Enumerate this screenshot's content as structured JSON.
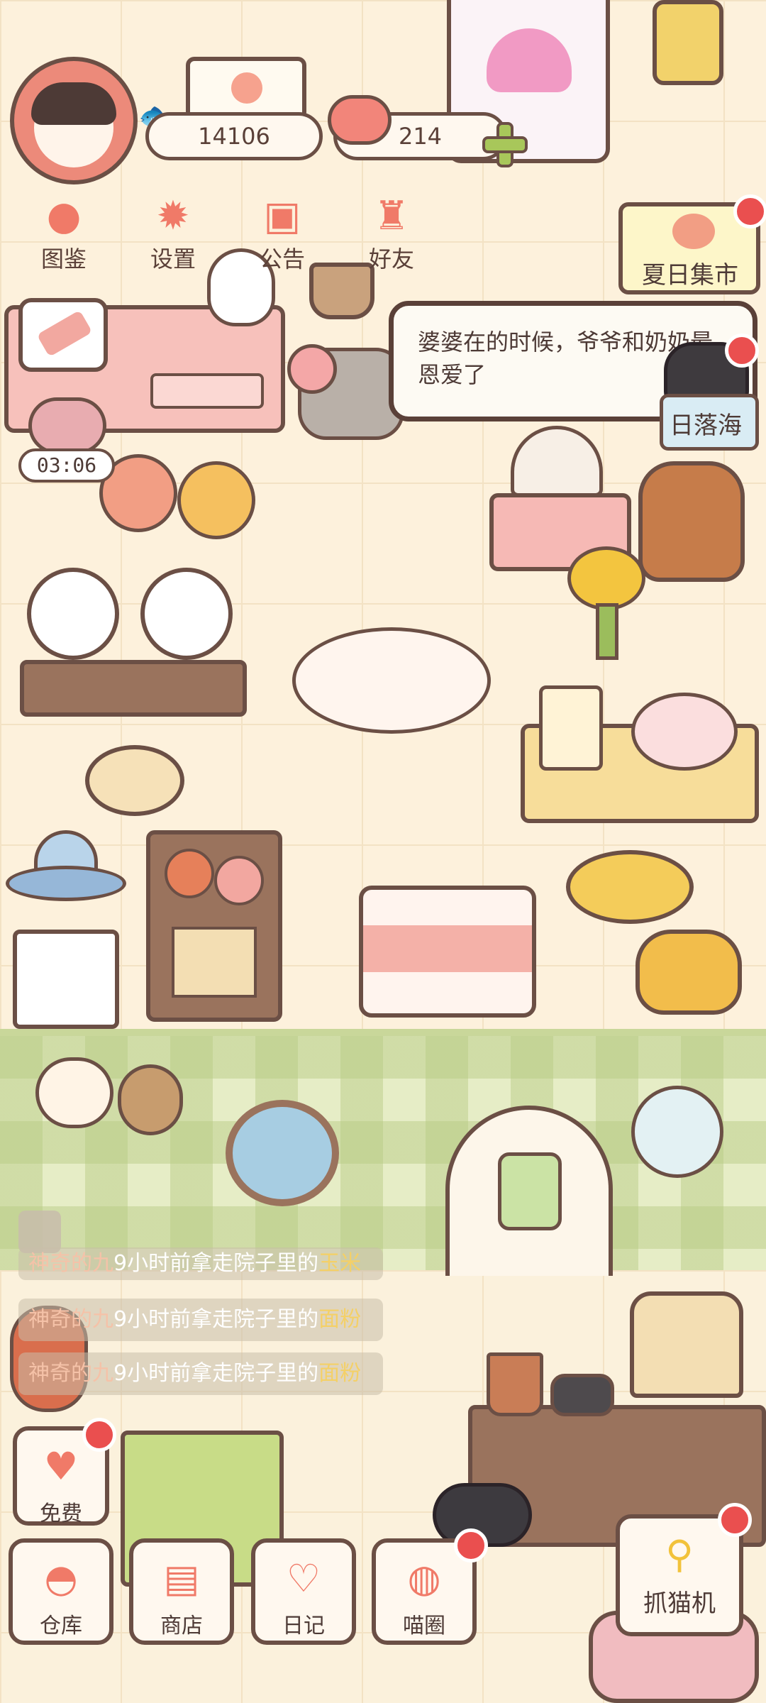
{
  "hud": {
    "coins": "14106",
    "hearts": "214",
    "menu": [
      {
        "label": "图鉴",
        "icon": "cat-head-icon"
      },
      {
        "label": "设置",
        "icon": "gear-icon"
      },
      {
        "label": "公告",
        "icon": "gift-icon"
      },
      {
        "label": "好友",
        "icon": "friends-icon"
      }
    ]
  },
  "events": {
    "summer_market": "夏日集市",
    "sunset_sea": "日落海"
  },
  "dialog": {
    "text": "婆婆在的时候，爷爷和奶奶最恩爱了"
  },
  "timer": "03:06",
  "feed": [
    {
      "who": "神奇的九",
      "mid": "9小时前拿走院子里的",
      "item": "玉米"
    },
    {
      "who": "神奇的九",
      "mid": "9小时前拿走院子里的",
      "item": "面粉"
    },
    {
      "who": "神奇的九",
      "mid": "9小时前拿走院子里的",
      "item": "面粉"
    }
  ],
  "bottom": {
    "free": "免费",
    "warehouse": "仓库",
    "shop": "商店",
    "diary": "日记",
    "meow_circle": "喵圈",
    "claw_machine": "抓猫机"
  },
  "colors": {
    "accent": "#f07a68",
    "outline": "#6b4f45",
    "badge_red": "#ea4f4f",
    "wall_green": "#e6edc6"
  }
}
